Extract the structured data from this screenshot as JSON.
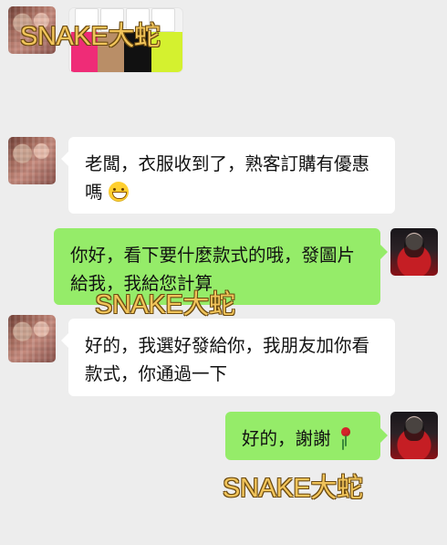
{
  "chat": {
    "watermarks": [
      "SNAKE大蛇",
      "SNAKE大蛇",
      "SNAKE大蛇"
    ],
    "messages": [
      {
        "text": "老闆，衣服收到了，熟客訂購有優惠嗎",
        "emoji": "grinning-face"
      },
      {
        "text": "你好，看下要什麼款式的哦，發圖片給我，我給您計算"
      },
      {
        "text": "好的，我選好發給你，我朋友加你看款式，你通過一下"
      },
      {
        "text": "好的，謝謝",
        "emoji": "rose"
      }
    ]
  }
}
